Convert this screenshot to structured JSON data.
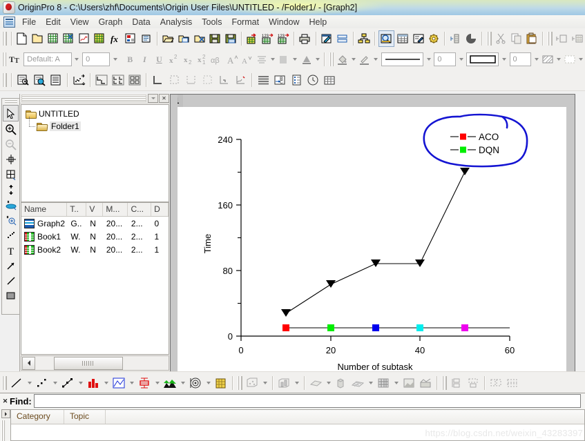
{
  "window": {
    "title": "OriginPro 8 - C:\\Users\\zhf\\Documents\\Origin User Files\\UNTITLED - /Folder1/ - [Graph2]",
    "app_icon": "origin-app-icon"
  },
  "menu": {
    "items": [
      {
        "label": "File",
        "name": "menu-file"
      },
      {
        "label": "Edit",
        "name": "menu-edit"
      },
      {
        "label": "View",
        "name": "menu-view"
      },
      {
        "label": "Graph",
        "name": "menu-graph"
      },
      {
        "label": "Data",
        "name": "menu-data"
      },
      {
        "label": "Analysis",
        "name": "menu-analysis"
      },
      {
        "label": "Tools",
        "name": "menu-tools"
      },
      {
        "label": "Format",
        "name": "menu-format"
      },
      {
        "label": "Window",
        "name": "menu-window"
      },
      {
        "label": "Help",
        "name": "menu-help"
      }
    ]
  },
  "format_toolbar": {
    "style_value": "Default: A",
    "font_size_value": "0",
    "line_width_value": "0",
    "frame_width_value": "0"
  },
  "project_explorer": {
    "tree": [
      {
        "label": "UNTITLED",
        "icon": "folder-icon"
      },
      {
        "label": "Folder1",
        "icon": "folder-open-icon"
      }
    ],
    "columns": [
      "Name",
      "T..",
      "V",
      "M...",
      "C...",
      "D"
    ],
    "rows": [
      {
        "name": "Graph2",
        "icon": "graph-window-icon",
        "type": "G..",
        "v": "N",
        "modified": "20...",
        "created": "2...",
        "d": "0"
      },
      {
        "name": "Book1",
        "icon": "workbook-icon",
        "type": "W.",
        "v": "N",
        "modified": "20...",
        "created": "2...",
        "d": "1"
      },
      {
        "name": "Book2",
        "icon": "workbook-icon",
        "type": "W.",
        "v": "N",
        "modified": "20...",
        "created": "2...",
        "d": "1"
      }
    ]
  },
  "graph_window": {
    "layer_tab": "1"
  },
  "find_panel": {
    "label": "Find:",
    "input_value": "",
    "columns": [
      "Category",
      "Topic"
    ]
  },
  "watermark": "https://blog.csdn.net/weixin_43283397",
  "colors": {
    "aco_marker": "#ff0000",
    "dqn_marker": "#00ee00",
    "annotation_circle": "#1414d2",
    "series_blue": "#0000ee",
    "series_cyan": "#00eeee",
    "series_magenta": "#ee00ee"
  },
  "chart_data": {
    "type": "line",
    "title": "",
    "xlabel": "Number of subtask",
    "ylabel": "Time",
    "xlim": [
      0,
      60
    ],
    "ylim": [
      0,
      240
    ],
    "xticks": [
      0,
      20,
      40,
      60
    ],
    "yticks": [
      0,
      80,
      160,
      240
    ],
    "grid": false,
    "legend_position": "top-right",
    "legend": [
      {
        "name": "ACO",
        "marker": "square",
        "color": "#ff0000"
      },
      {
        "name": "DQN",
        "marker": "square",
        "color": "#00ee00"
      }
    ],
    "x": [
      10,
      20,
      30,
      40,
      50
    ],
    "series": [
      {
        "name": "ACO",
        "marker": "down-triangle",
        "color": "#000000",
        "values": [
          28,
          61,
          88,
          88,
          200
        ]
      },
      {
        "name": "DQN",
        "marker": "square",
        "color": "#000000",
        "marker_colors": [
          "#ff0000",
          "#00ee00",
          "#0000ee",
          "#00eeee",
          "#ee00ee"
        ],
        "values": [
          10,
          10,
          10,
          10,
          10
        ]
      }
    ],
    "annotations": [
      {
        "type": "freehand-ellipse",
        "color": "#1414d2",
        "target": "legend"
      }
    ]
  }
}
